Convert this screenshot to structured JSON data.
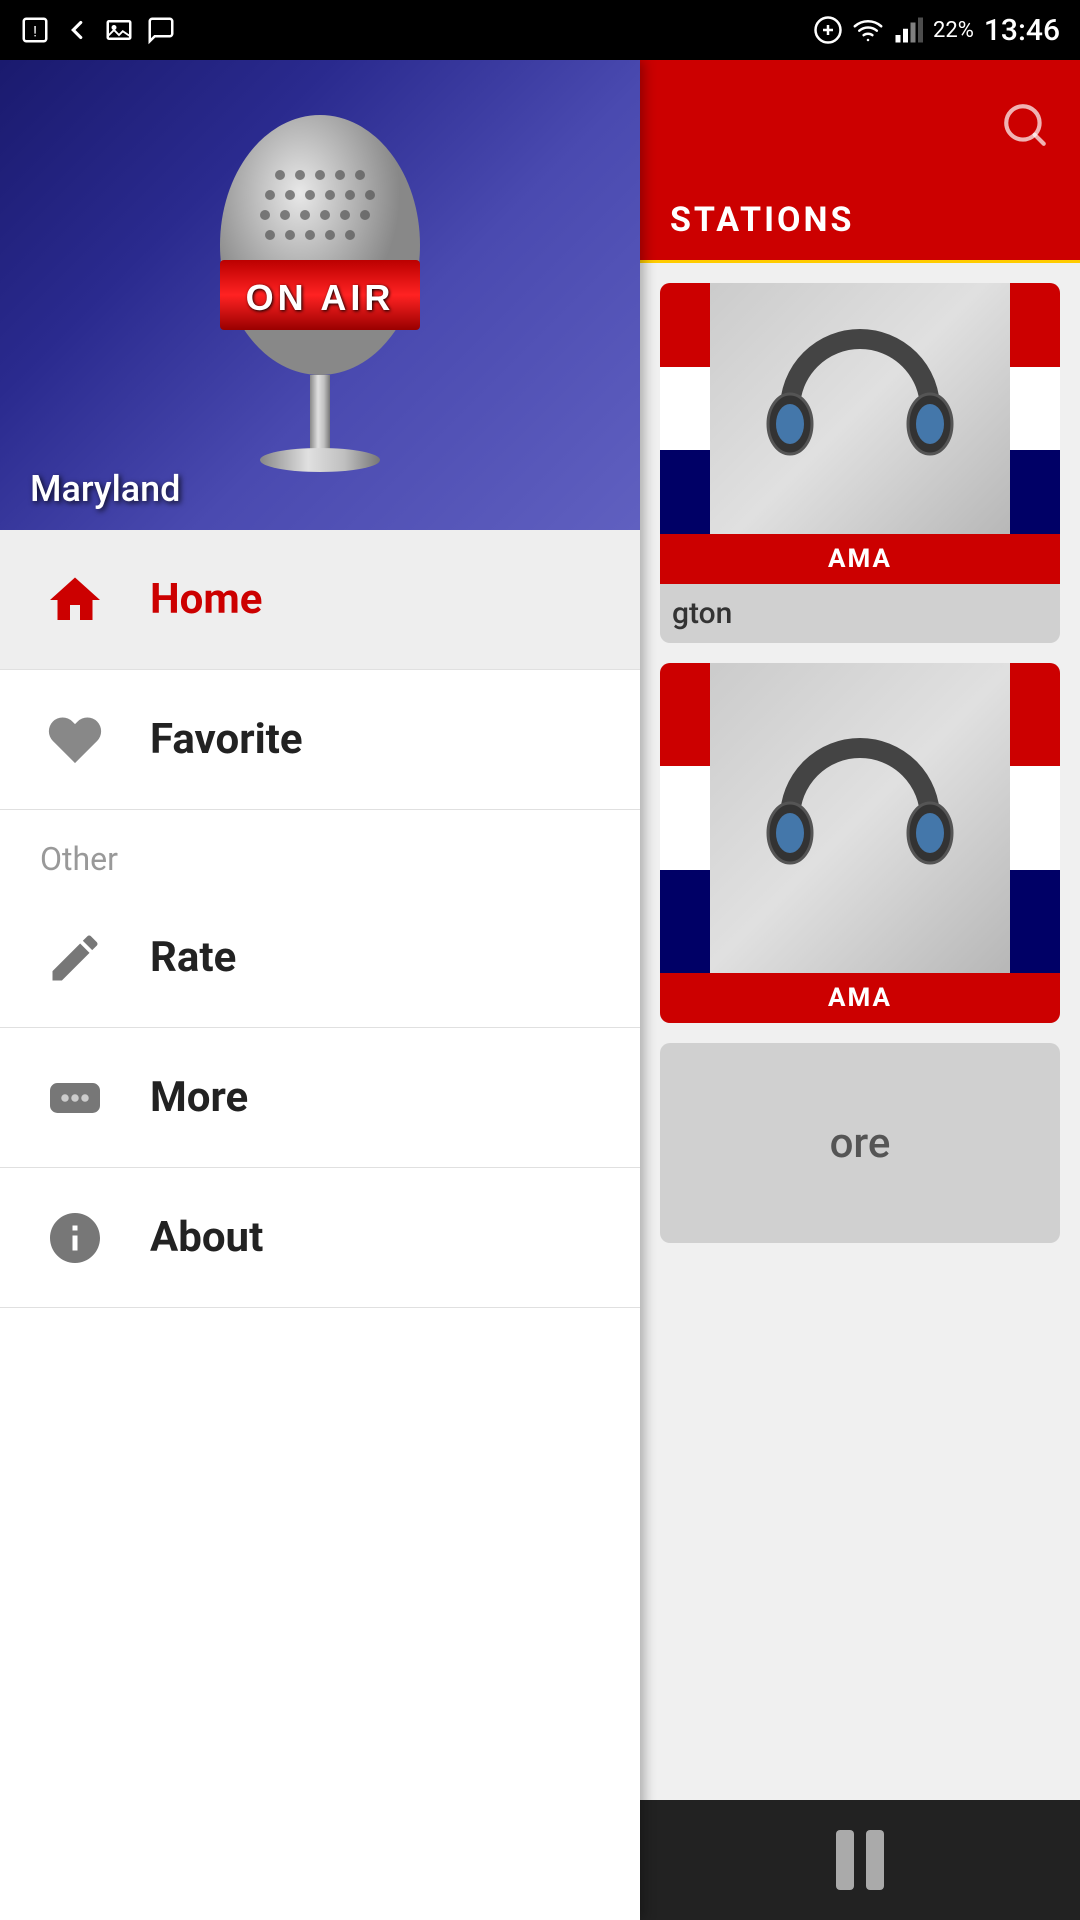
{
  "statusBar": {
    "time": "13:46",
    "battery": "22%"
  },
  "hero": {
    "onAirText": "ON AIR",
    "locationLabel": "Maryland"
  },
  "menu": {
    "items": [
      {
        "id": "home",
        "label": "Home",
        "icon": "home-icon",
        "active": true
      },
      {
        "id": "favorite",
        "label": "Favorite",
        "icon": "heart-icon",
        "active": false
      }
    ],
    "sectionHeader": "Other",
    "otherItems": [
      {
        "id": "rate",
        "label": "Rate",
        "icon": "rate-icon"
      },
      {
        "id": "more",
        "label": "More",
        "icon": "more-icon"
      },
      {
        "id": "about",
        "label": "About",
        "icon": "info-icon"
      }
    ]
  },
  "rightPanel": {
    "stationsTitle": "STATIONS",
    "stations": [
      {
        "id": 1,
        "abbr": "AMA",
        "name": "gton"
      },
      {
        "id": 2,
        "abbr": "AMA",
        "name": ""
      }
    ],
    "moreLabel": "ore"
  }
}
